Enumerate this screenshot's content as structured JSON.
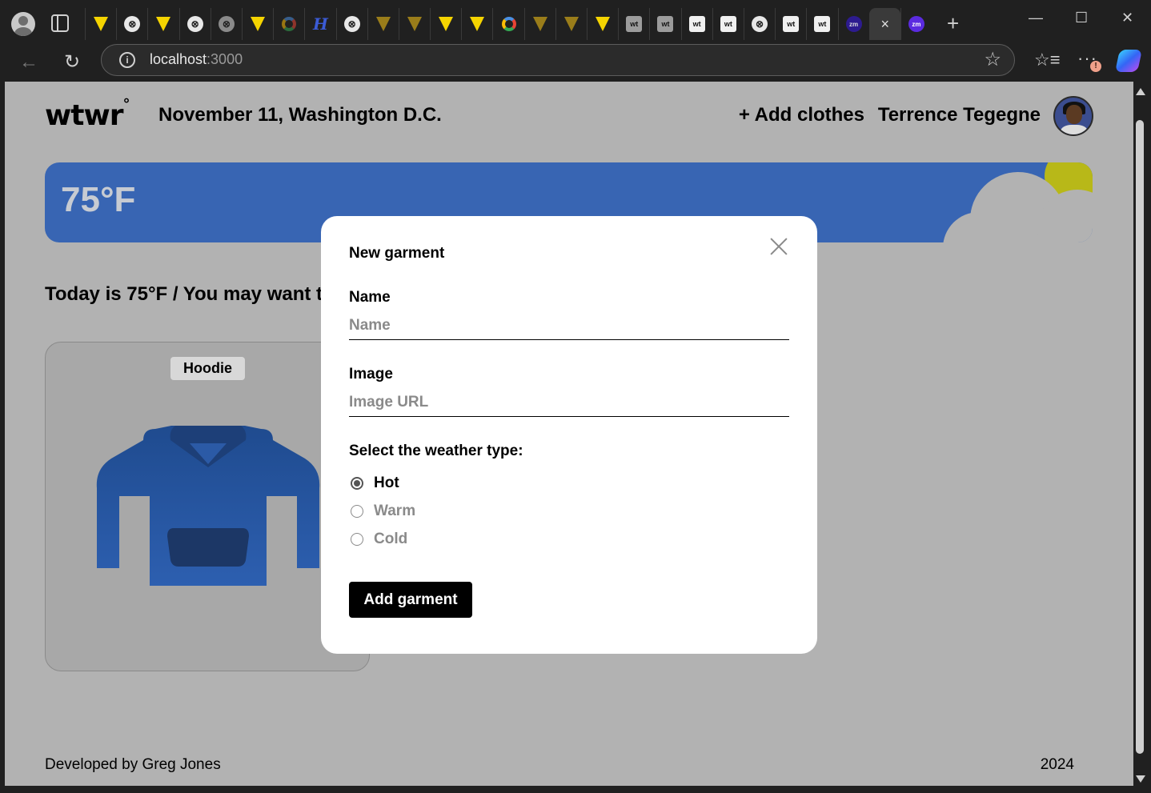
{
  "browser": {
    "url_host": "localhost",
    "url_port": ":3000",
    "tabs": [
      {
        "icon": "vite-icon"
      },
      {
        "icon": "doc-icon"
      },
      {
        "icon": "vite-icon"
      },
      {
        "icon": "doc-icon"
      },
      {
        "icon": "doc-icon"
      },
      {
        "icon": "vite-icon"
      },
      {
        "icon": "google-icon"
      },
      {
        "icon": "h-icon"
      },
      {
        "icon": "doc-icon"
      },
      {
        "icon": "vite-icon"
      },
      {
        "icon": "vite-icon"
      },
      {
        "icon": "vite-icon"
      },
      {
        "icon": "vite-icon"
      },
      {
        "icon": "google-icon"
      },
      {
        "icon": "vite-icon"
      },
      {
        "icon": "vite-icon"
      },
      {
        "icon": "vite-icon"
      },
      {
        "icon": "wt-icon"
      },
      {
        "icon": "wt-icon"
      },
      {
        "icon": "wt-icon"
      },
      {
        "icon": "wt-icon"
      },
      {
        "icon": "doc-icon"
      },
      {
        "icon": "wt-icon"
      },
      {
        "icon": "wt-icon"
      },
      {
        "icon": "zm-icon"
      },
      {
        "icon": "close-icon",
        "active": true
      },
      {
        "icon": "zm-icon"
      }
    ],
    "glyphs": {
      "doc": "⊗",
      "h": "H",
      "wt": "wt",
      "zm": "zm",
      "close": "×",
      "back": "←",
      "reload": "↻",
      "info": "i",
      "star": "☆",
      "favorites": "☆≡",
      "more": "···",
      "more_badge": "!",
      "new_tab": "+",
      "minimize": "—",
      "maximize": "☐",
      "window_close": "✕"
    }
  },
  "header": {
    "logo": "wtwr",
    "logo_degree": "°",
    "date_location": "November 11, Washington D.C.",
    "add_clothes": "+ Add clothes",
    "username": "Terrence Tegegne"
  },
  "weather": {
    "temperature": "75°F",
    "banner_color": "#3865b3",
    "message": "Today is 75°F / You may want to wear:"
  },
  "cards": [
    {
      "name": "Hoodie",
      "icon": "hoodie-icon",
      "color": "#2a5cac"
    }
  ],
  "footer": {
    "developer": "Developed by Greg Jones",
    "year": "2024"
  },
  "modal": {
    "title": "New garment",
    "name_label": "Name",
    "name_placeholder": "Name",
    "name_value": "",
    "image_label": "Image",
    "image_placeholder": "Image URL",
    "image_value": "",
    "weather_label": "Select the weather type:",
    "options": [
      {
        "label": "Hot",
        "checked": true
      },
      {
        "label": "Warm",
        "checked": false
      },
      {
        "label": "Cold",
        "checked": false
      }
    ],
    "submit_label": "Add garment"
  }
}
